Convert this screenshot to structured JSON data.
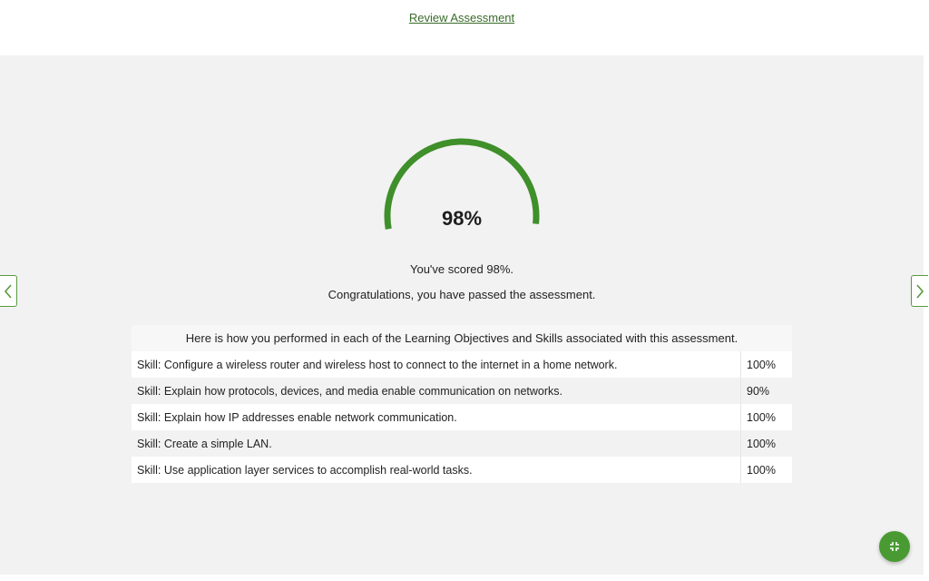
{
  "header": {
    "review_link": "Review Assessment"
  },
  "score": {
    "display": "98%",
    "value": 98,
    "accent_color": "#3f8f2a",
    "scored_message": "You've scored 98%.",
    "congrats_message": "Congratulations, you have passed the assessment."
  },
  "results": {
    "header": "Here is how you performed in each of the Learning Objectives and Skills associated with this assessment.",
    "rows": [
      {
        "skill": "Skill: Configure a wireless router and wireless host to connect to the internet in a home network.",
        "percent": "100%"
      },
      {
        "skill": "Skill: Explain how protocols, devices, and media enable communication on networks.",
        "percent": "90%"
      },
      {
        "skill": "Skill: Explain how IP addresses enable network communication.",
        "percent": "100%"
      },
      {
        "skill": "Skill: Create a simple LAN.",
        "percent": "100%"
      },
      {
        "skill": "Skill: Use application layer services to accomplish real-world tasks.",
        "percent": "100%"
      }
    ]
  },
  "icons": {
    "prev": "chevron-left-icon",
    "next": "chevron-right-icon",
    "fab": "collapse-icon"
  }
}
